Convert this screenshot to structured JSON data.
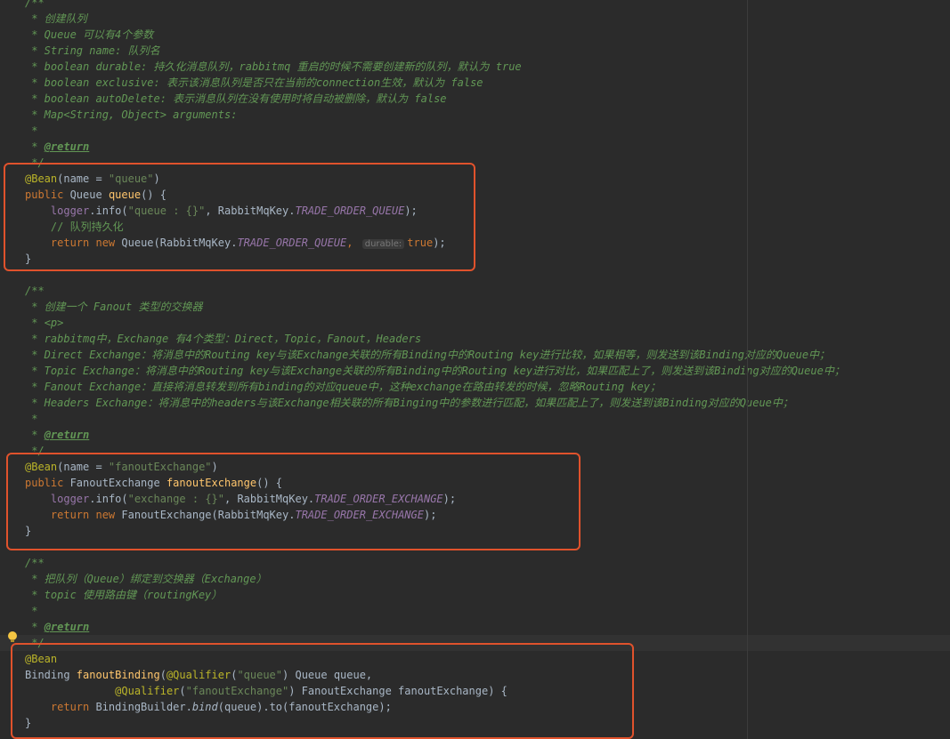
{
  "editor": {
    "lines": [
      [
        {
          "t": "/**",
          "c": "cm"
        }
      ],
      [
        {
          "t": " * 创建队列",
          "c": "cm"
        }
      ],
      [
        {
          "t": " * Queue 可以有4个参数",
          "c": "cm"
        }
      ],
      [
        {
          "t": " * String name: 队列名",
          "c": "cm"
        }
      ],
      [
        {
          "t": " * boolean durable: 持久化消息队列，rabbitmq 重启的时候不需要创建新的队列，默认为 true",
          "c": "cm"
        }
      ],
      [
        {
          "t": " * boolean exclusive: 表示该消息队列是否只在当前的connection生效，默认为 false",
          "c": "cm"
        }
      ],
      [
        {
          "t": " * boolean autoDelete: 表示消息队列在没有使用时将自动被删除，默认为 false",
          "c": "cm"
        }
      ],
      [
        {
          "t": " * Map<String, Object> arguments:",
          "c": "cm"
        }
      ],
      [
        {
          "t": " *",
          "c": "cm"
        }
      ],
      [
        {
          "t": " * ",
          "c": "cm"
        },
        {
          "t": "@return",
          "c": "tag"
        }
      ],
      [
        {
          "t": " */",
          "c": "cm"
        }
      ],
      [
        {
          "t": "@Bean",
          "c": "ann"
        },
        {
          "t": "(name = ",
          "c": "plain"
        },
        {
          "t": "\"queue\"",
          "c": "str"
        },
        {
          "t": ")",
          "c": "plain"
        }
      ],
      [
        {
          "t": "public ",
          "c": "kw"
        },
        {
          "t": "Queue ",
          "c": "plain"
        },
        {
          "t": "queue",
          "c": "fn"
        },
        {
          "t": "() {",
          "c": "plain"
        }
      ],
      [
        {
          "t": "    ",
          "c": "plain"
        },
        {
          "t": "logger",
          "c": "field"
        },
        {
          "t": ".info(",
          "c": "plain"
        },
        {
          "t": "\"queue : {}\"",
          "c": "str"
        },
        {
          "t": ", RabbitMqKey.",
          "c": "plain"
        },
        {
          "t": "TRADE_ORDER_QUEUE",
          "c": "static"
        },
        {
          "t": ");",
          "c": "plain"
        }
      ],
      [
        {
          "t": "    // 队列持久化",
          "c": "cm-plain"
        }
      ],
      [
        {
          "t": "    ",
          "c": "plain"
        },
        {
          "t": "return new ",
          "c": "kw"
        },
        {
          "t": "Queue(RabbitMqKey.",
          "c": "plain"
        },
        {
          "t": "TRADE_ORDER_QUEUE",
          "c": "static"
        },
        {
          "t": ", ",
          "c": "kw"
        },
        {
          "t": "durable:",
          "c": "hint"
        },
        {
          "t": "true",
          "c": "kw"
        },
        {
          "t": ");",
          "c": "plain"
        }
      ],
      [
        {
          "t": "}",
          "c": "plain"
        }
      ],
      [
        {
          "t": "",
          "c": "plain"
        }
      ],
      [
        {
          "t": "/**",
          "c": "cm"
        }
      ],
      [
        {
          "t": " * 创建一个 Fanout 类型的交换器",
          "c": "cm"
        }
      ],
      [
        {
          "t": " * ",
          "c": "cm"
        },
        {
          "t": "<p>",
          "c": "html"
        }
      ],
      [
        {
          "t": " * rabbitmq中，Exchange 有4个类型：Direct，Topic，Fanout，Headers",
          "c": "cm"
        }
      ],
      [
        {
          "t": " * Direct Exchange：将消息中的Routing key与该Exchange关联的所有Binding中的Routing key进行比较，如果相等，则发送到该Binding对应的Queue中；",
          "c": "cm"
        }
      ],
      [
        {
          "t": " * Topic Exchange：将消息中的Routing key与该Exchange关联的所有Binding中的Routing key进行对比，如果匹配上了，则发送到该Binding对应的Queue中；",
          "c": "cm"
        }
      ],
      [
        {
          "t": " * Fanout Exchange：直接将消息转发到所有binding的对应queue中，这种exchange在路由转发的时候，忽略Routing key；",
          "c": "cm"
        }
      ],
      [
        {
          "t": " * Headers Exchange：将消息中的headers与该Exchange相关联的所有Binging中的参数进行匹配，如果匹配上了，则发送到该Binding对应的Queue中；",
          "c": "cm"
        }
      ],
      [
        {
          "t": " *",
          "c": "cm"
        }
      ],
      [
        {
          "t": " * ",
          "c": "cm"
        },
        {
          "t": "@return",
          "c": "tag"
        }
      ],
      [
        {
          "t": " */",
          "c": "cm"
        }
      ],
      [
        {
          "t": "@Bean",
          "c": "ann"
        },
        {
          "t": "(name = ",
          "c": "plain"
        },
        {
          "t": "\"fanoutExchange\"",
          "c": "str"
        },
        {
          "t": ")",
          "c": "plain"
        }
      ],
      [
        {
          "t": "public ",
          "c": "kw"
        },
        {
          "t": "FanoutExchange ",
          "c": "plain"
        },
        {
          "t": "fanoutExchange",
          "c": "fn"
        },
        {
          "t": "() {",
          "c": "plain"
        }
      ],
      [
        {
          "t": "    ",
          "c": "plain"
        },
        {
          "t": "logger",
          "c": "field"
        },
        {
          "t": ".info(",
          "c": "plain"
        },
        {
          "t": "\"exchange : {}\"",
          "c": "str"
        },
        {
          "t": ", RabbitMqKey.",
          "c": "plain"
        },
        {
          "t": "TRADE_ORDER_EXCHANGE",
          "c": "static"
        },
        {
          "t": ");",
          "c": "plain"
        }
      ],
      [
        {
          "t": "    ",
          "c": "plain"
        },
        {
          "t": "return new ",
          "c": "kw"
        },
        {
          "t": "FanoutExchange(RabbitMqKey.",
          "c": "plain"
        },
        {
          "t": "TRADE_ORDER_EXCHANGE",
          "c": "static"
        },
        {
          "t": ");",
          "c": "plain"
        }
      ],
      [
        {
          "t": "}",
          "c": "plain"
        }
      ],
      [
        {
          "t": "",
          "c": "plain"
        }
      ],
      [
        {
          "t": "/**",
          "c": "cm"
        }
      ],
      [
        {
          "t": " * 把队列（Queue）绑定到交换器（Exchange）",
          "c": "cm"
        }
      ],
      [
        {
          "t": " * topic 使用路由键（routingKey）",
          "c": "cm"
        }
      ],
      [
        {
          "t": " *",
          "c": "cm"
        }
      ],
      [
        {
          "t": " * ",
          "c": "cm"
        },
        {
          "t": "@return",
          "c": "tag"
        }
      ],
      [
        {
          "t": " */",
          "c": "cm"
        }
      ],
      [
        {
          "t": "@Bean",
          "c": "ann"
        }
      ],
      [
        {
          "t": "Binding ",
          "c": "plain"
        },
        {
          "t": "fanoutBinding",
          "c": "fn"
        },
        {
          "t": "(",
          "c": "plain"
        },
        {
          "t": "@Qualifier",
          "c": "ann"
        },
        {
          "t": "(",
          "c": "plain"
        },
        {
          "t": "\"queue\"",
          "c": "str"
        },
        {
          "t": ") Queue queue,",
          "c": "plain"
        }
      ],
      [
        {
          "t": "              ",
          "c": "plain"
        },
        {
          "t": "@Qualifier",
          "c": "ann"
        },
        {
          "t": "(",
          "c": "plain"
        },
        {
          "t": "\"fanoutExchange\"",
          "c": "str"
        },
        {
          "t": ") FanoutExchange fanoutExchange) {",
          "c": "plain"
        }
      ],
      [
        {
          "t": "    ",
          "c": "plain"
        },
        {
          "t": "return ",
          "c": "kw"
        },
        {
          "t": "BindingBuilder.",
          "c": "plain"
        },
        {
          "t": "bind",
          "c": "it"
        },
        {
          "t": "(queue).to(fanoutExchange);",
          "c": "plain"
        }
      ],
      [
        {
          "t": "}",
          "c": "plain"
        }
      ]
    ],
    "caret_line": 40
  },
  "colors": {
    "background": "#2b2b2b",
    "highlight_box": "#e0522c",
    "comment": "#629755",
    "keyword": "#cc7832",
    "annotation": "#bbb529",
    "string": "#6a8759",
    "method": "#ffc66d",
    "static_field": "#9876aa"
  },
  "icons": {
    "gutter": "lightbulb-icon"
  }
}
